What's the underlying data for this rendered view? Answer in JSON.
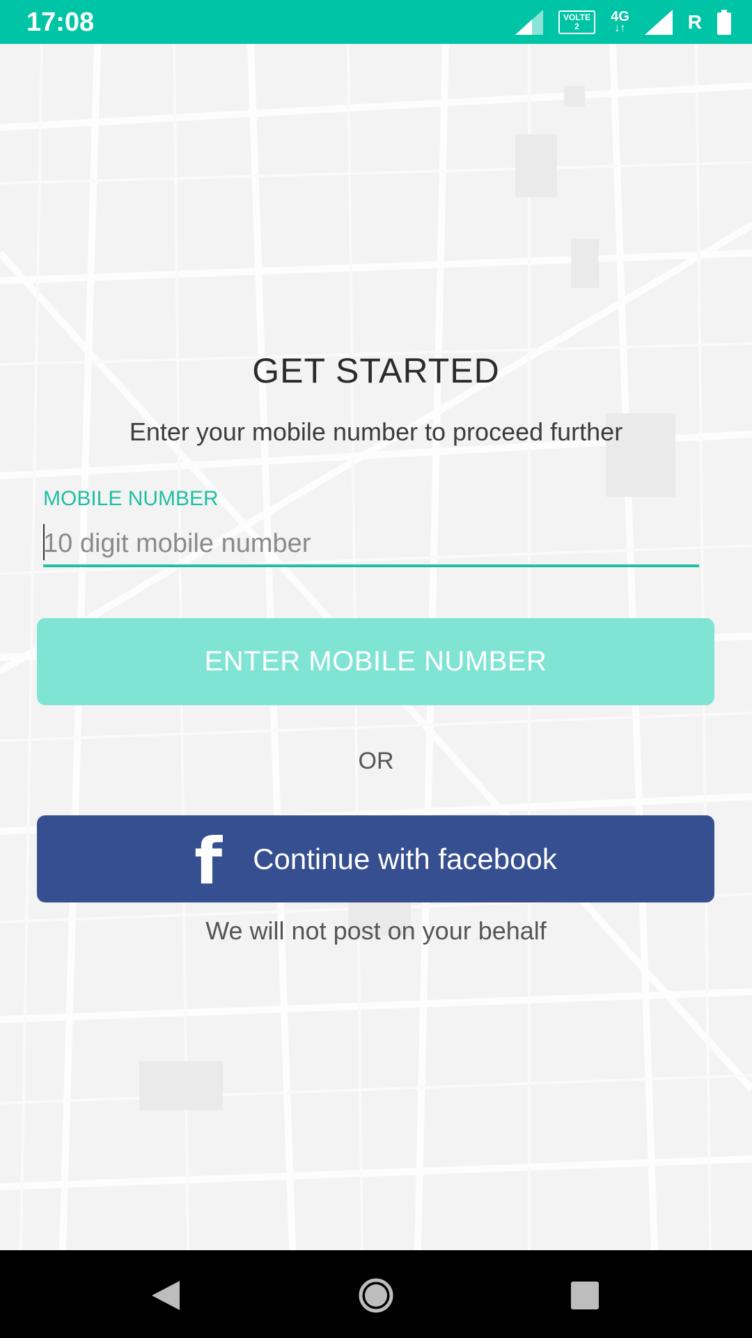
{
  "status_bar": {
    "time": "17:08",
    "volte_line1": "VOLTE",
    "volte_line2": "2",
    "network": "4G",
    "roaming": "R"
  },
  "icons": {
    "signal": "signal-icon",
    "volte": "volte-icon",
    "data": "data-arrows-icon",
    "battery": "battery-icon",
    "facebook": "facebook-icon",
    "back": "back-icon",
    "home": "home-icon",
    "recents": "recents-icon"
  },
  "colors": {
    "accent": "#1fbfa2",
    "status_bar": "#00c4a6",
    "enter_button": "#80e4d4",
    "facebook": "#364f91"
  },
  "main": {
    "title": "GET STARTED",
    "subtitle": "Enter your mobile number to proceed further",
    "field_label": "MOBILE NUMBER",
    "field_placeholder": "10 digit mobile number",
    "field_value": "",
    "enter_button_label": "ENTER MOBILE NUMBER",
    "or_text": "OR",
    "facebook_glyph": "f",
    "facebook_button_label": "Continue with facebook",
    "disclaimer": "We will not post on your behalf"
  }
}
